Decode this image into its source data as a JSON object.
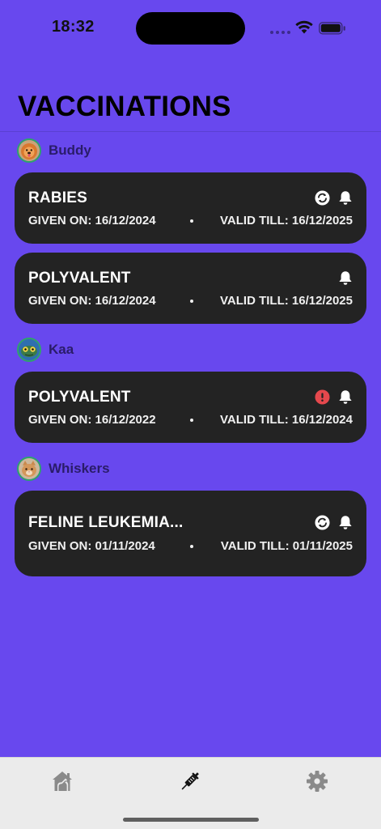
{
  "status_bar": {
    "time": "18:32"
  },
  "page": {
    "title": "VACCINATIONS"
  },
  "pets": [
    {
      "name": "Buddy",
      "avatar_icon": "dog-avatar-icon",
      "vaccines": [
        {
          "name": "RABIES",
          "given_label": "GIVEN ON: 16/12/2024",
          "valid_label": "VALID TILL: 16/12/2025",
          "icons": [
            "recurring-icon",
            "bell-icon"
          ]
        },
        {
          "name": "POLYVALENT",
          "given_label": "GIVEN ON: 16/12/2024",
          "valid_label": "VALID TILL: 16/12/2025",
          "icons": [
            "bell-icon"
          ]
        }
      ]
    },
    {
      "name": "Kaa",
      "avatar_icon": "snake-avatar-icon",
      "vaccines": [
        {
          "name": "POLYVALENT",
          "given_label": "GIVEN ON: 16/12/2022",
          "valid_label": "VALID TILL: 16/12/2024",
          "icons": [
            "expired-alert-icon",
            "bell-icon"
          ]
        }
      ]
    },
    {
      "name": "Whiskers",
      "avatar_icon": "cat-avatar-icon",
      "vaccines": [
        {
          "name": "FELINE LEUKEMIA...",
          "given_label": "GIVEN ON: 01/11/2024",
          "valid_label": "VALID TILL: 01/11/2025",
          "icons": [
            "recurring-icon",
            "bell-icon"
          ]
        }
      ]
    }
  ],
  "tab_bar": {
    "tabs": [
      {
        "icon": "pet-house-icon",
        "active": false
      },
      {
        "icon": "syringe-icon",
        "active": true
      },
      {
        "icon": "gear-icon",
        "active": false
      }
    ]
  },
  "colors": {
    "background": "#6848EE",
    "card": "#232323",
    "alert": "#E5484D",
    "tab_bar": "#EBEBEB"
  }
}
